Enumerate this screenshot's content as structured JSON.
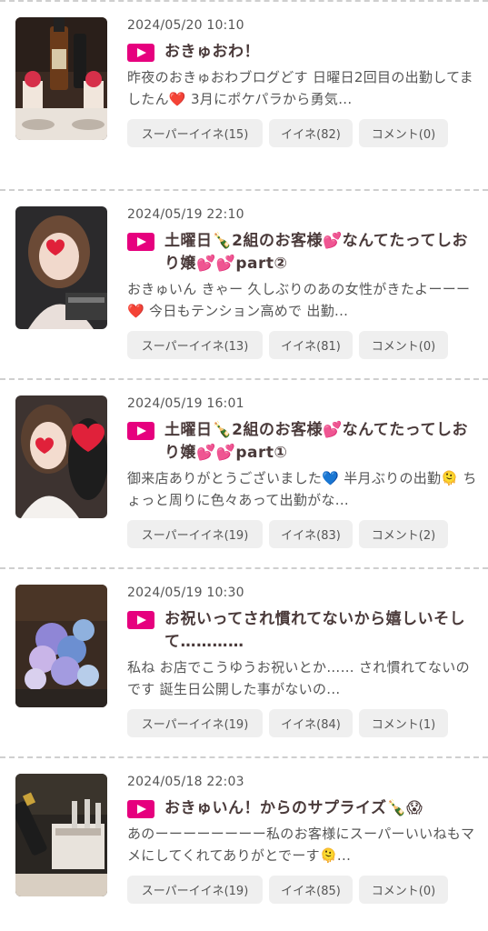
{
  "posts": [
    {
      "date": "2024/05/20 10:10",
      "title": "おきゅおわ！",
      "excerpt": "昨夜のおきゅおわブログどす 日曜日2回目の出勤してましたん❤️ 3月にポケパラから勇気...",
      "super_like": "スーパーイイネ(15)",
      "like": "イイネ(82)",
      "comment": "コメント(0)",
      "thumb": "bottles-and-parfaits"
    },
    {
      "date": "2024/05/19 22:10",
      "title": "土曜日🍾2組のお客様💕なんてたってしおり嬢💕💕part②",
      "excerpt": "おきゅいん きゃー 久しぶりのあの女性がきたよーーー❤️ 今日もテンション高めで 出勤...",
      "super_like": "スーパーイイネ(13)",
      "like": "イイネ(81)",
      "comment": "コメント(0)",
      "thumb": "selfie-heart"
    },
    {
      "date": "2024/05/19 16:01",
      "title": "土曜日🍾2組のお客様💕なんてたってしおり嬢💕💕part①",
      "excerpt": " 御来店ありがとうございました💙 半月ぶりの出勤🫠 ちょっと周りに色々あって出勤がな...",
      "super_like": "スーパーイイネ(19)",
      "like": "イイネ(83)",
      "comment": "コメント(2)",
      "thumb": "photo-two-hearts"
    },
    {
      "date": "2024/05/19 10:30",
      "title": "お祝いってされ慣れてないから嬉しいそして…………",
      "excerpt": "私ね お店でこうゆうお祝いとか…… され慣れてないのです 誕生日公開した事がないの...",
      "super_like": "スーパーイイネ(19)",
      "like": "イイネ(84)",
      "comment": "コメント(1)",
      "thumb": "flower-bouquet"
    },
    {
      "date": "2024/05/18 22:03",
      "title": "おきゅいん！からのサプライズ🍾😱",
      "excerpt": "あのーーーーーーーー私のお客様にスーパーいいねもマメにしてくれてありがとでーす🫠...",
      "super_like": "スーパーイイネ(19)",
      "like": "イイネ(85)",
      "comment": "コメント(0)",
      "thumb": "champagne-glasses"
    }
  ],
  "colors": {
    "accent": "#e6007e",
    "button_bg": "#efefef",
    "divider": "#cfcfcf"
  }
}
